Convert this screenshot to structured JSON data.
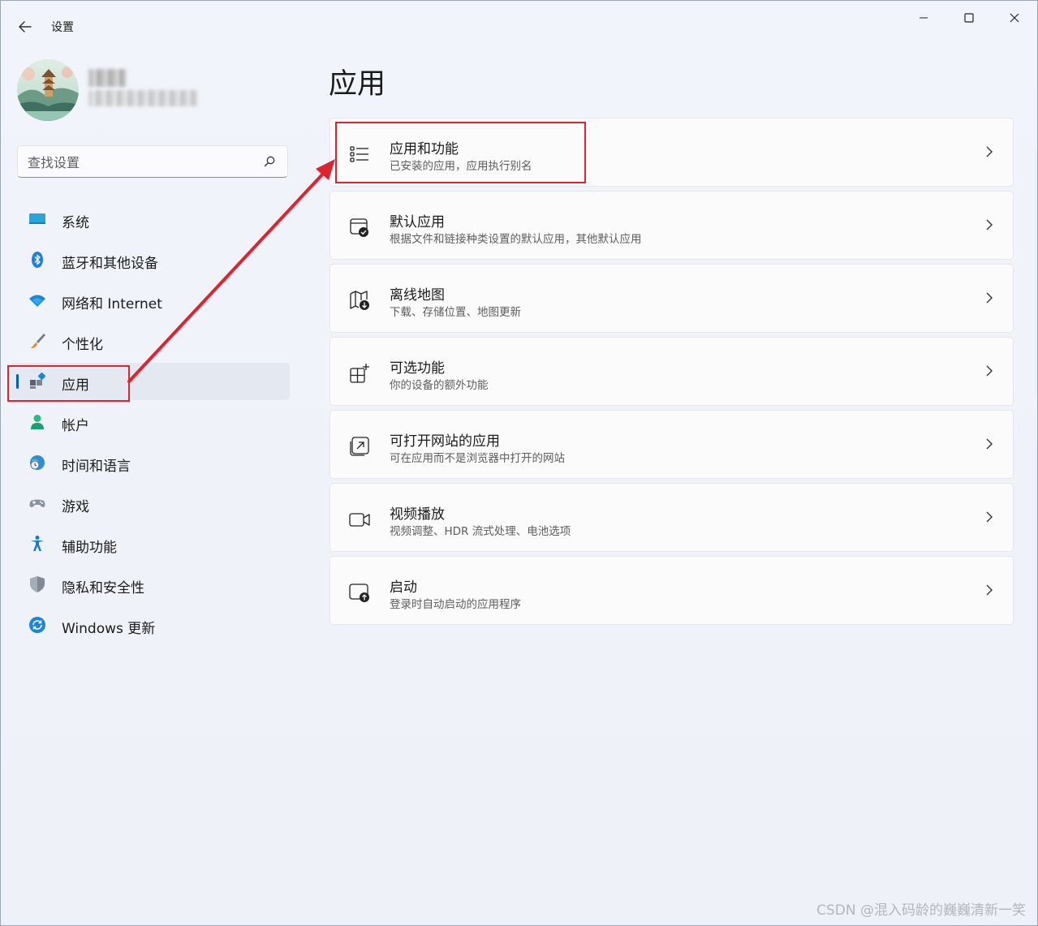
{
  "titlebar": {
    "app_title": "设置"
  },
  "search": {
    "placeholder": "查找设置"
  },
  "nav": {
    "items": [
      {
        "label": "系统",
        "icon": "monitor-icon"
      },
      {
        "label": "蓝牙和其他设备",
        "icon": "bluetooth-icon"
      },
      {
        "label": "网络和 Internet",
        "icon": "wifi-icon"
      },
      {
        "label": "个性化",
        "icon": "paintbrush-icon"
      },
      {
        "label": "应用",
        "icon": "apps-icon",
        "active": true
      },
      {
        "label": "帐户",
        "icon": "person-icon"
      },
      {
        "label": "时间和语言",
        "icon": "globe-clock-icon"
      },
      {
        "label": "游戏",
        "icon": "gamepad-icon"
      },
      {
        "label": "辅助功能",
        "icon": "accessibility-icon"
      },
      {
        "label": "隐私和安全性",
        "icon": "shield-icon"
      },
      {
        "label": "Windows 更新",
        "icon": "update-icon"
      }
    ]
  },
  "main": {
    "title": "应用",
    "cards": [
      {
        "title": "应用和功能",
        "subtitle": "已安装的应用，应用执行别名",
        "icon": "list-icon"
      },
      {
        "title": "默认应用",
        "subtitle": "根据文件和链接种类设置的默认应用，其他默认应用",
        "icon": "default-app-icon"
      },
      {
        "title": "离线地图",
        "subtitle": "下载、存储位置、地图更新",
        "icon": "map-download-icon"
      },
      {
        "title": "可选功能",
        "subtitle": "你的设备的额外功能",
        "icon": "add-feature-icon"
      },
      {
        "title": "可打开网站的应用",
        "subtitle": "可在应用而不是浏览器中打开的网站",
        "icon": "open-external-icon"
      },
      {
        "title": "视频播放",
        "subtitle": "视频调整、HDR 流式处理、电池选项",
        "icon": "video-icon"
      },
      {
        "title": "启动",
        "subtitle": "登录时自动启动的应用程序",
        "icon": "startup-icon"
      }
    ]
  },
  "colors": {
    "accent": "#005fb8",
    "annotation": "#e0242f"
  },
  "watermark": "CSDN @混入码龄的巍巍清新一笑"
}
